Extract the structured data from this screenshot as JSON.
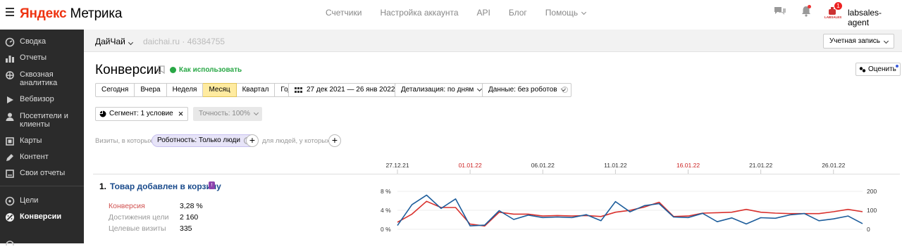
{
  "header": {
    "brand_yandex": "Яндекс",
    "brand_metrika": "Метрика",
    "nav": [
      "Счетчики",
      "Настройка аккаунта",
      "API",
      "Блог",
      "Помощь"
    ],
    "notification_badge": "1",
    "avatar_label": "LABSALES",
    "username": "labsales-agent"
  },
  "sidebar": {
    "items": [
      {
        "label": "Сводка",
        "icon": "gauge-icon"
      },
      {
        "label": "Отчеты",
        "icon": "bar-chart-icon"
      },
      {
        "label": "Сквозная аналитика",
        "icon": "network-icon"
      },
      {
        "label": "Вебвизор",
        "icon": "play-icon"
      },
      {
        "label": "Посетители и клиенты",
        "icon": "users-icon"
      },
      {
        "label": "Карты",
        "icon": "map-icon"
      },
      {
        "label": "Контент",
        "icon": "pen-icon"
      },
      {
        "label": "Свои отчеты",
        "icon": "report-icon"
      },
      {
        "label": "Цели",
        "icon": "target-icon"
      },
      {
        "label": "Конверсии",
        "icon": "conversion-icon"
      }
    ]
  },
  "counter": {
    "name": "ДайЧай",
    "site": "daichai.ru · 46384755",
    "account_button": "Учетная запись"
  },
  "page": {
    "title": "Конверсии",
    "how_to_use": "Как использовать",
    "rate_button": "Оценить"
  },
  "period": {
    "buttons": [
      "Сегодня",
      "Вчера",
      "Неделя",
      "Месяц",
      "Квартал",
      "Год"
    ],
    "active": "Месяц",
    "date_range": "27 дек 2021 — 26 янв 2022",
    "detail": "Детализация: по дням",
    "data": "Данные: без роботов"
  },
  "segment": {
    "label": "Сегмент: 1 условие",
    "accuracy": "Точность: 100%"
  },
  "filter": {
    "prefix": "Визиты, в которых",
    "chip": "Роботность: Только люди",
    "middle": "для людей, у которых"
  },
  "goal": {
    "number": "1.",
    "name": "Товар добавлен в корзину",
    "metrics": [
      {
        "key": "Конверсия",
        "value": "3,28 %",
        "color": "#d0504f"
      },
      {
        "key": "Достижения цели",
        "value": "2 160",
        "color": "#999999"
      },
      {
        "key": "Целевые визиты",
        "value": "335",
        "color": "#999999"
      }
    ]
  },
  "chart_data": {
    "type": "line",
    "x_tick_labels": [
      "27.12.21",
      "01.01.22",
      "06.01.22",
      "11.01.22",
      "16.01.22",
      "21.01.22",
      "26.01.22"
    ],
    "x_tick_colors": [
      "#333333",
      "#cc2222",
      "#333333",
      "#333333",
      "#cc2222",
      "#333333",
      "#333333"
    ],
    "left_axis_labels": [
      "8 %",
      "4 %",
      "0 %"
    ],
    "right_axis_labels": [
      "200",
      "100",
      "0"
    ],
    "ylim_left": [
      0,
      8
    ],
    "ylim_right": [
      0,
      200
    ],
    "series": [
      {
        "color": "#d9302c",
        "axis": "left",
        "values": [
          1.5,
          3.2,
          5.9,
          4.6,
          4.6,
          1.1,
          0.7,
          3.6,
          3.2,
          3.2,
          2.8,
          2.9,
          2.8,
          2.9,
          2.7,
          3.6,
          4.0,
          4.7,
          5.7,
          2.7,
          2.8,
          3.4,
          3.5,
          3.6,
          4.2,
          3.6,
          3.4,
          3.3,
          3.3,
          3.3,
          3.7,
          4.2,
          3.7
        ],
        "color_name": "red"
      },
      {
        "color": "#1d5d9b",
        "axis": "right",
        "values": [
          20,
          130,
          180,
          110,
          160,
          18,
          22,
          98,
          52,
          75,
          62,
          65,
          62,
          77,
          45,
          146,
          92,
          125,
          135,
          65,
          62,
          84,
          40,
          60,
          28,
          61,
          58,
          76,
          83,
          45,
          55,
          70,
          30
        ],
        "color_name": "blue"
      }
    ]
  }
}
